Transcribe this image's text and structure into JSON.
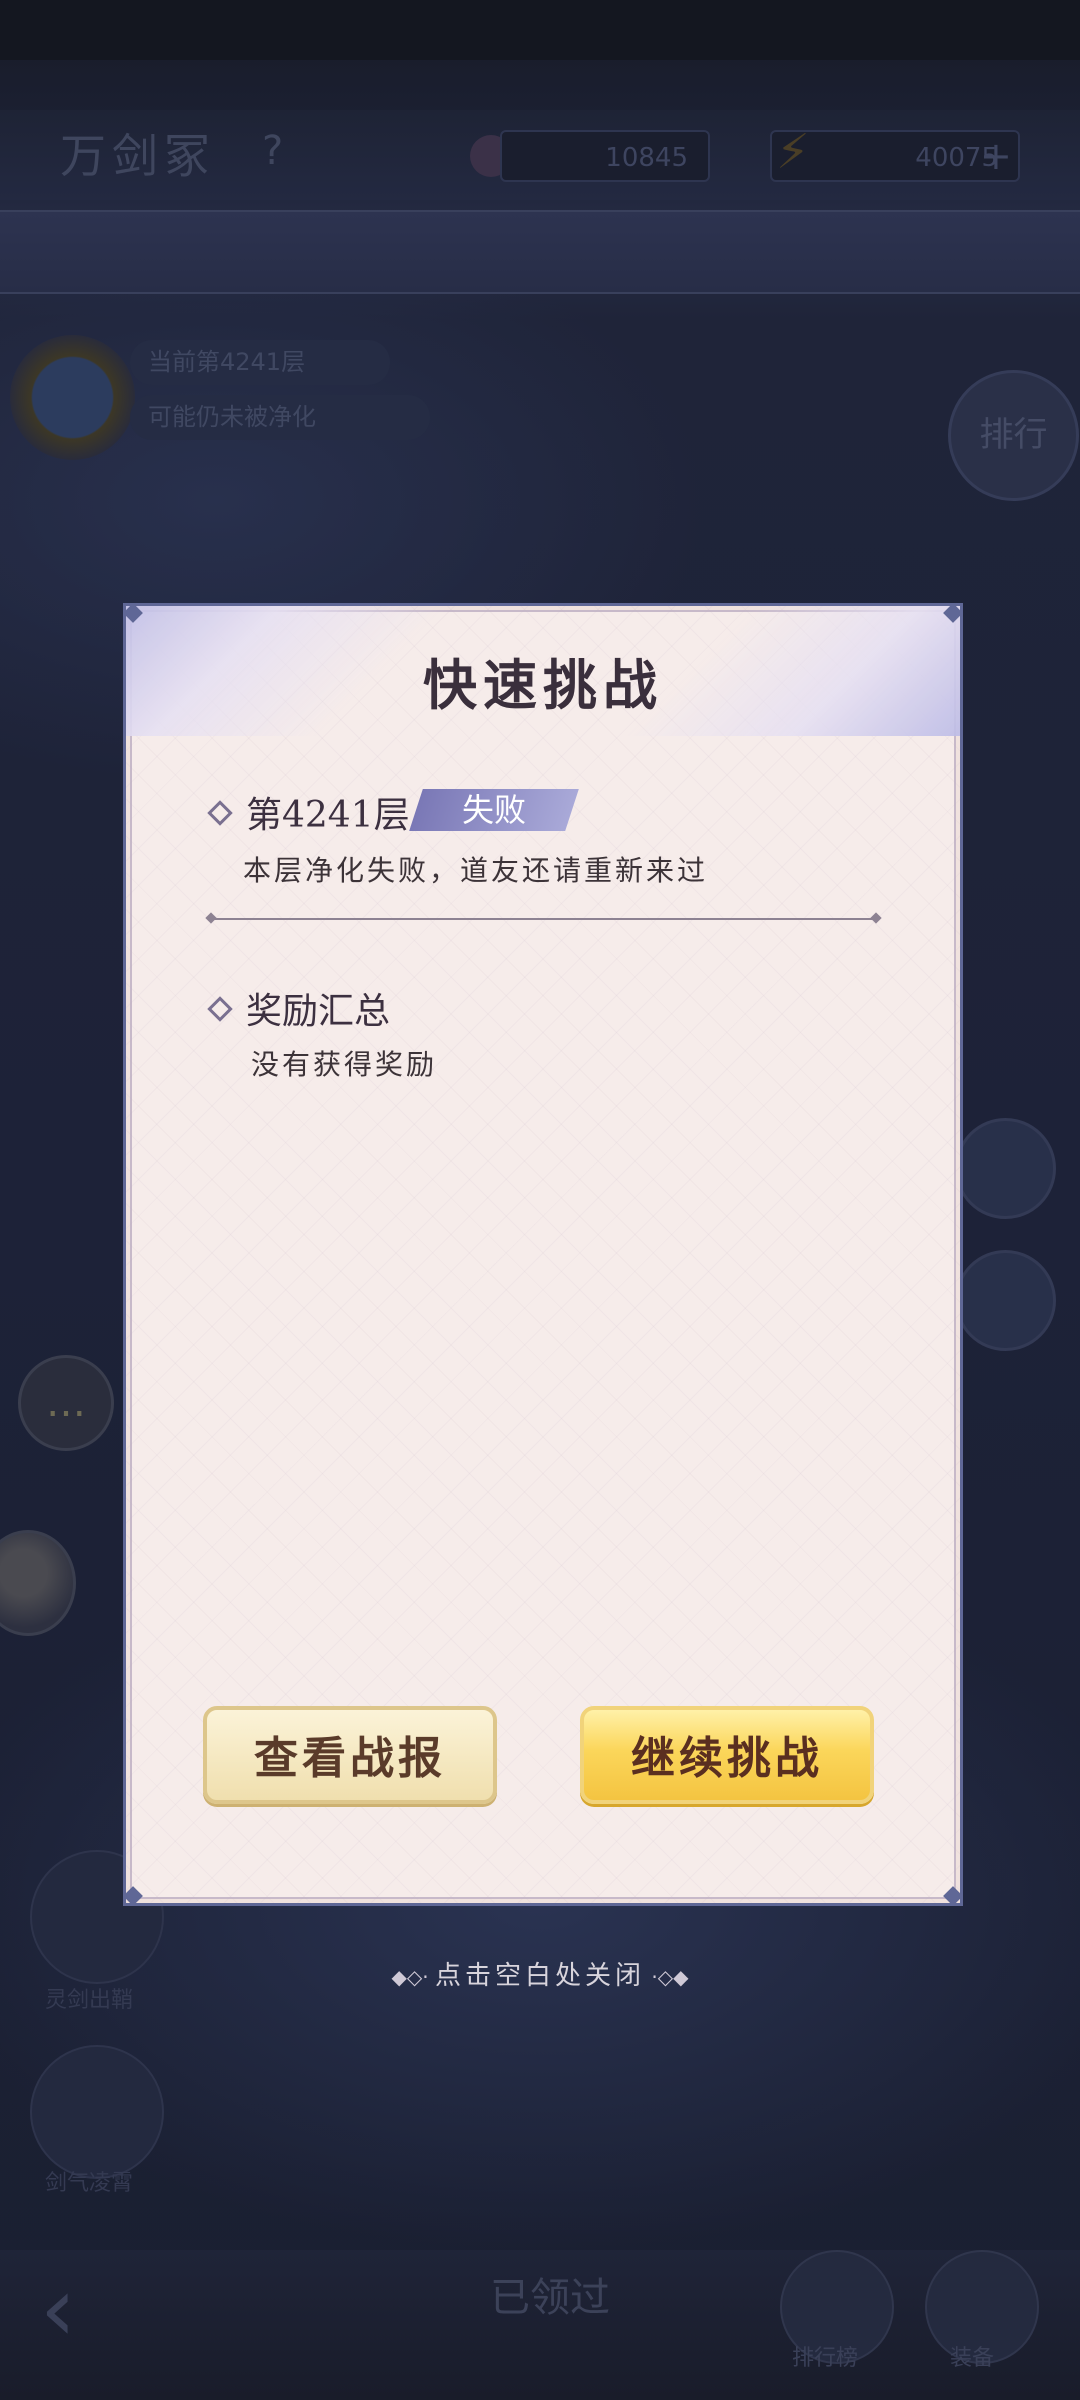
{
  "background": {
    "top_title": "万剑冢",
    "resource_1": "10845",
    "resource_2": "40075",
    "floor_line_1": "当前第4241层",
    "floor_line_2": "可能仍未被净化",
    "rank_label": "排行",
    "bottom_center": "已领过",
    "bottom_left_label_1": "灵剑出鞘",
    "bottom_left_label_2": "剑气凌霄",
    "bottom_right_label_1": "排行榜",
    "bottom_right_label_2": "装备"
  },
  "modal": {
    "title": "快速挑战",
    "floor": {
      "label": "第4241层",
      "status_badge": "失败",
      "status_color": "#8f8dc6",
      "message": "本层净化失败，道友还请重新来过"
    },
    "rewards": {
      "heading": "奖励汇总",
      "message": "没有获得奖励"
    },
    "buttons": {
      "view_report": "查看战报",
      "continue_challenge": "继续挑战"
    }
  },
  "close_hint": "点击空白处关闭"
}
